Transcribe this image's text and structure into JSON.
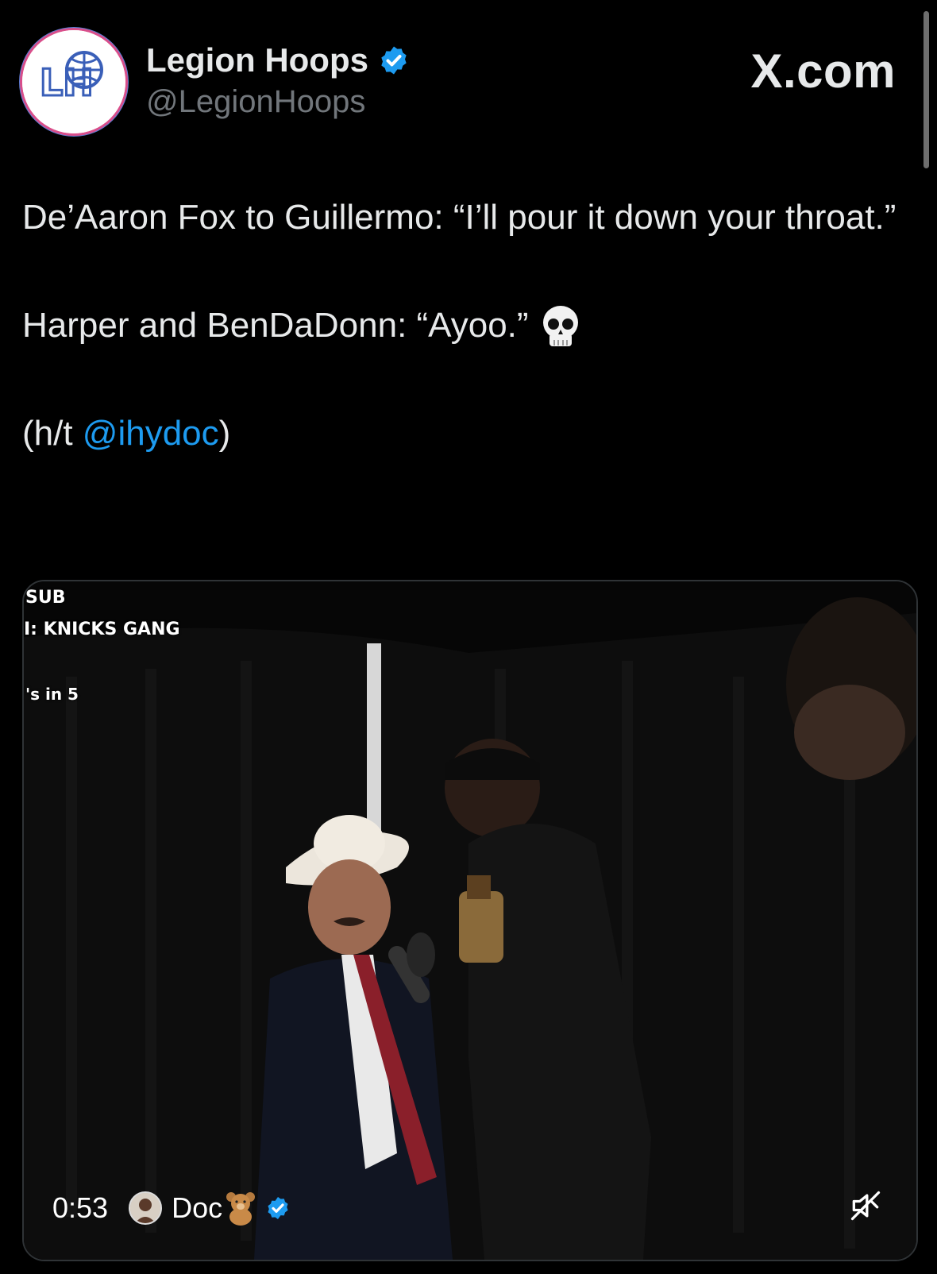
{
  "header": {
    "display_name": "Legion Hoops",
    "handle": "@LegionHoops",
    "brand": "X.com",
    "avatar_monogram": "LH",
    "avatar_icon": "legion-hoops-logo",
    "verified_icon": "verified-badge"
  },
  "tweet": {
    "line1": "De’Aaron Fox to Guillermo: “I’ll pour it down your throat.”",
    "line2": "Harper and BenDaDonn: “Ayoo.”",
    "line2_emoji": "skull-emoji",
    "line3_prefix": "(h/t ",
    "line3_mention": "@ihydoc",
    "line3_suffix": ")"
  },
  "media": {
    "overlay_line1": "SUB",
    "overlay_line2": "I: KNICKS GANG",
    "overlay_line3": "'s in 5",
    "timestamp": "0:53",
    "creator_name": "Doc",
    "creator_emoji": "teddy-bear-emoji",
    "mute_icon": "muted-speaker-icon"
  },
  "colors": {
    "background": "#000000",
    "text": "#e7e9ea",
    "secondary": "#71767b",
    "accent": "#1d9bf0"
  }
}
